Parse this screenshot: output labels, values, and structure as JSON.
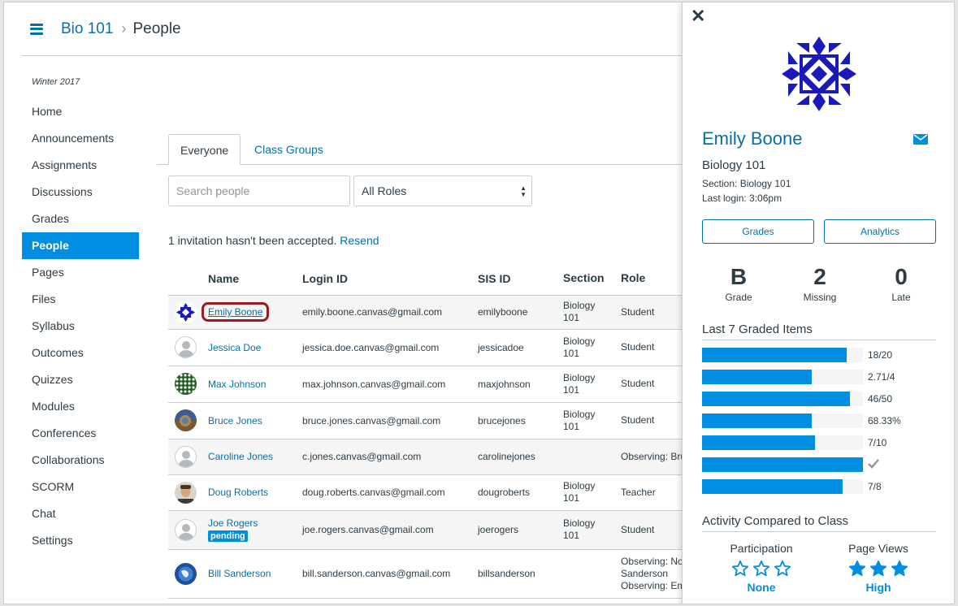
{
  "breadcrumb": {
    "course": "Bio 101",
    "separator": "›",
    "current": "People"
  },
  "sidebar": {
    "term": "Winter 2017",
    "items": [
      {
        "label": "Home",
        "active": false
      },
      {
        "label": "Announcements",
        "active": false
      },
      {
        "label": "Assignments",
        "active": false
      },
      {
        "label": "Discussions",
        "active": false
      },
      {
        "label": "Grades",
        "active": false
      },
      {
        "label": "People",
        "active": true
      },
      {
        "label": "Pages",
        "active": false
      },
      {
        "label": "Files",
        "active": false
      },
      {
        "label": "Syllabus",
        "active": false
      },
      {
        "label": "Outcomes",
        "active": false
      },
      {
        "label": "Quizzes",
        "active": false
      },
      {
        "label": "Modules",
        "active": false
      },
      {
        "label": "Conferences",
        "active": false
      },
      {
        "label": "Collaborations",
        "active": false
      },
      {
        "label": "SCORM",
        "active": false
      },
      {
        "label": "Chat",
        "active": false
      },
      {
        "label": "Settings",
        "active": false
      }
    ]
  },
  "tabs": [
    {
      "label": "Everyone",
      "active": true
    },
    {
      "label": "Class Groups",
      "active": false
    }
  ],
  "search": {
    "placeholder": "Search people"
  },
  "role_filter": {
    "selected": "All Roles"
  },
  "invitation": {
    "text": "1 invitation hasn't been accepted.",
    "link": "Resend"
  },
  "table": {
    "headers": [
      "Name",
      "Login ID",
      "SIS ID",
      "Section",
      "Role"
    ],
    "rows": [
      {
        "name": "Emily Boone",
        "login": "emily.boone.canvas@gmail.com",
        "sis": "emilyboone",
        "section": [
          "Biology",
          "101"
        ],
        "role": [
          "Student"
        ],
        "avatar": "pattern-blue",
        "pending": ""
      },
      {
        "name": "Jessica Doe",
        "login": "jessica.doe.canvas@gmail.com",
        "sis": "jessicadoe",
        "section": [
          "Biology",
          "101"
        ],
        "role": [
          "Student"
        ],
        "avatar": "default",
        "pending": ""
      },
      {
        "name": "Max Johnson",
        "login": "max.johnson.canvas@gmail.com",
        "sis": "maxjohnson",
        "section": [
          "Biology",
          "101"
        ],
        "role": [
          "Student"
        ],
        "avatar": "pattern-green",
        "pending": ""
      },
      {
        "name": "Bruce Jones",
        "login": "bruce.jones.canvas@gmail.com",
        "sis": "brucejones",
        "section": [
          "Biology",
          "101"
        ],
        "role": [
          "Student"
        ],
        "avatar": "photo-landscape",
        "pending": ""
      },
      {
        "name": "Caroline Jones",
        "login": "c.jones.canvas@gmail.com",
        "sis": "carolinejones",
        "section": [
          "",
          ""
        ],
        "role": [
          "Observing: Bru"
        ],
        "avatar": "default",
        "pending": ""
      },
      {
        "name": "Doug Roberts",
        "login": "doug.roberts.canvas@gmail.com",
        "sis": "dougroberts",
        "section": [
          "Biology",
          "101"
        ],
        "role": [
          "Teacher"
        ],
        "avatar": "photo-person",
        "pending": ""
      },
      {
        "name": "Joe Rogers",
        "login": "joe.rogers.canvas@gmail.com",
        "sis": "joerogers",
        "section": [
          "Biology",
          "101"
        ],
        "role": [
          "Student"
        ],
        "avatar": "default",
        "pending": "pending"
      },
      {
        "name": "Bill Sanderson",
        "login": "bill.sanderson.canvas@gmail.com",
        "sis": "billsanderson",
        "section": [
          "",
          ""
        ],
        "role": [
          "Observing: No",
          "Sanderson",
          "Observing: Em"
        ],
        "avatar": "photo-globe",
        "pending": ""
      }
    ]
  },
  "tray": {
    "close_icon": "close-icon",
    "name": "Emily Boone",
    "course": "Biology 101",
    "section": "Section: Biology 101",
    "last_login": "Last login: 3:06pm",
    "buttons": {
      "grades": "Grades",
      "analytics": "Analytics"
    },
    "stats": [
      {
        "value": "B",
        "label": "Grade"
      },
      {
        "value": "2",
        "label": "Missing"
      },
      {
        "value": "0",
        "label": "Late"
      }
    ],
    "graded_title": "Last 7 Graded Items",
    "graded_items": [
      {
        "label": "18/20",
        "fraction": 0.9,
        "icon": ""
      },
      {
        "label": "2.71/4",
        "fraction": 0.68,
        "icon": ""
      },
      {
        "label": "46/50",
        "fraction": 0.92,
        "icon": ""
      },
      {
        "label": "68.33%",
        "fraction": 0.6833,
        "icon": ""
      },
      {
        "label": "7/10",
        "fraction": 0.7,
        "icon": ""
      },
      {
        "label": "",
        "fraction": 1.0,
        "icon": "checkmark-icon"
      },
      {
        "label": "7/8",
        "fraction": 0.875,
        "icon": ""
      }
    ],
    "activity_title": "Activity Compared to Class",
    "activity": [
      {
        "label": "Participation",
        "level": "None",
        "stars_filled": 0
      },
      {
        "label": "Page Views",
        "level": "High",
        "stars_filled": 3
      }
    ]
  },
  "colors": {
    "accent": "#008ee2",
    "link": "#0770a3",
    "focus_ring": "#9c1b21",
    "text": "#2d3b45",
    "pattern_blue": "#1a1ab8",
    "pattern_green": "#1f5c1f"
  }
}
